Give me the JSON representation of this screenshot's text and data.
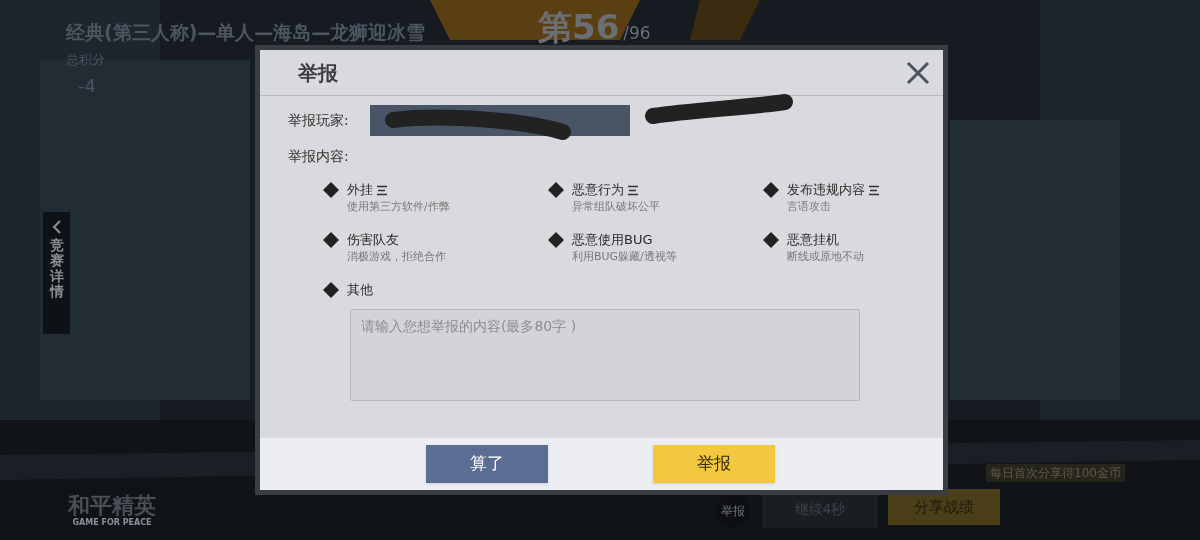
{
  "match": {
    "title": "经典(第三人称)—单人—海岛—龙狮迎冰雪",
    "score_label": "总积分",
    "score": "-4",
    "rank": "第56",
    "rank_total": "/96",
    "side_tab": "竞赛详情"
  },
  "logo": {
    "name": "和平精英",
    "tagline": "GAME FOR PEACE"
  },
  "bottom_bar": {
    "share_hint": "每日首次分享得100金币",
    "report_button": "举报",
    "continue_button": "继续4秒",
    "share_button": "分享战绩"
  },
  "dialog": {
    "title": "举报",
    "player_label": "举报玩家:",
    "content_label": "举报内容:",
    "options": [
      {
        "title": "外挂",
        "desc": "使用第三方软件/作弊",
        "expandable": true
      },
      {
        "title": "恶意行为",
        "desc": "异常组队破坏公平",
        "expandable": true
      },
      {
        "title": "发布违规内容",
        "desc": "言语攻击",
        "expandable": true
      },
      {
        "title": "伤害队友",
        "desc": "消极游戏，拒绝合作",
        "expandable": false
      },
      {
        "title": "恶意使用BUG",
        "desc": "利用BUG躲藏/透视等",
        "expandable": false
      },
      {
        "title": "恶意挂机",
        "desc": "断线或原地不动",
        "expandable": false
      },
      {
        "title": "其他",
        "expandable": false
      }
    ],
    "text_placeholder": "请输入您想举报的内容(最多80字 )",
    "buttons": [
      {
        "label": "算了",
        "kind": "cancel"
      },
      {
        "label": "举报",
        "kind": "confirm"
      }
    ]
  }
}
